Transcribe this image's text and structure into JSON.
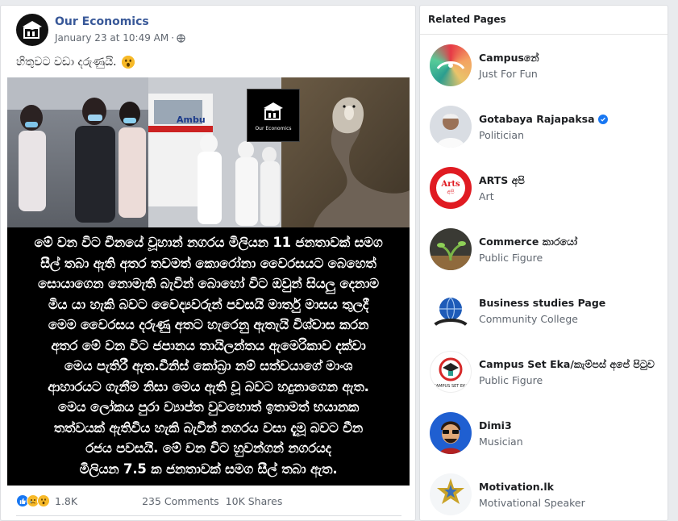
{
  "post": {
    "page_name": "Our Economics",
    "timestamp": "January 23 at 10:49 AM",
    "separator": "·",
    "privacy_icon": "globe-icon",
    "text": "හිතුවට වඩා දරුණුයි.",
    "text_emoji": "astonished-face-emoji",
    "image": {
      "logo_caption": "Our Economics",
      "ambulance_text": "Ambu",
      "lines": [
        "මේ වන විට චීනයේ වූහාන් නගරය මිලියන 11 ජනතාවක් සමග",
        "සීල් තබා ඇති අතර තවමත් කොරෝනා වෛරසයට බෙහෙත්",
        "සොයාගෙන නොමැති බැවින් බොහෝ විට ඔවුන් සියලු දෙනාම",
        "මිය යා හැකි බවට වෛද්‍යවරුන් පවසයි මාර්තු මාසය තුලදී",
        "මෙම වෛරසය දරුණු අතට හැරෙනු ඇතැයි විශ්වාස කරන",
        "අතර මේ වන විට ජපානය තායිලන්තය ඇමෙරිකාව දක්වා",
        "මෙය පැතිරී ඇත.චීනිස් කෝබ්‍රා නම් සත්වයාගේ මාංශ",
        "ආහාරයට ගැනීම නිසා මෙය ඇති වූ බවට හදුනාගෙන ඇත.",
        "මෙය ලෝකය පුරා ව්‍යාප්ත වුවහොත් ඉතාමත් භයානක",
        "තත්වයක් ඇතිවිය හැකි බැවින් නගරය වසා දැමූ බවට චීන",
        "රජය පවසයි. මේ වන විට හුවන්ගන් නගරයද",
        "මිලියන 7.5 ක ජනතාවක් සමග සීල් තබා ඇත."
      ]
    },
    "footer": {
      "reaction_count": "1.8K",
      "comments": "235 Comments",
      "shares": "10K Shares"
    }
  },
  "related_pages": {
    "title": "Related Pages",
    "items": [
      {
        "name": "Campusනේ",
        "category": "Just For Fun",
        "verified": false
      },
      {
        "name": "Gotabaya Rajapaksa",
        "category": "Politician",
        "verified": true
      },
      {
        "name": "ARTS අපි",
        "category": "Art",
        "verified": false,
        "avatar_text": "Arts",
        "avatar_sub": "අපි"
      },
      {
        "name": "Commerce කාරයෝ",
        "category": "Public Figure",
        "verified": false
      },
      {
        "name": "Business studies Page",
        "category": "Community College",
        "verified": false
      },
      {
        "name": "Campus Set Eka/කැම්පස් අපේ පිටුව",
        "category": "Public Figure",
        "verified": false,
        "avatar_text": "CAMPUS SET EKA"
      },
      {
        "name": "Dimi3",
        "category": "Musician",
        "verified": false
      },
      {
        "name": "Motivation.lk",
        "category": "Motivational Speaker",
        "verified": false
      }
    ]
  },
  "colors": {
    "link_blue": "#385898",
    "background": "#e9ebee",
    "like_blue": "#1877f2",
    "verified_blue": "#1877f2"
  }
}
